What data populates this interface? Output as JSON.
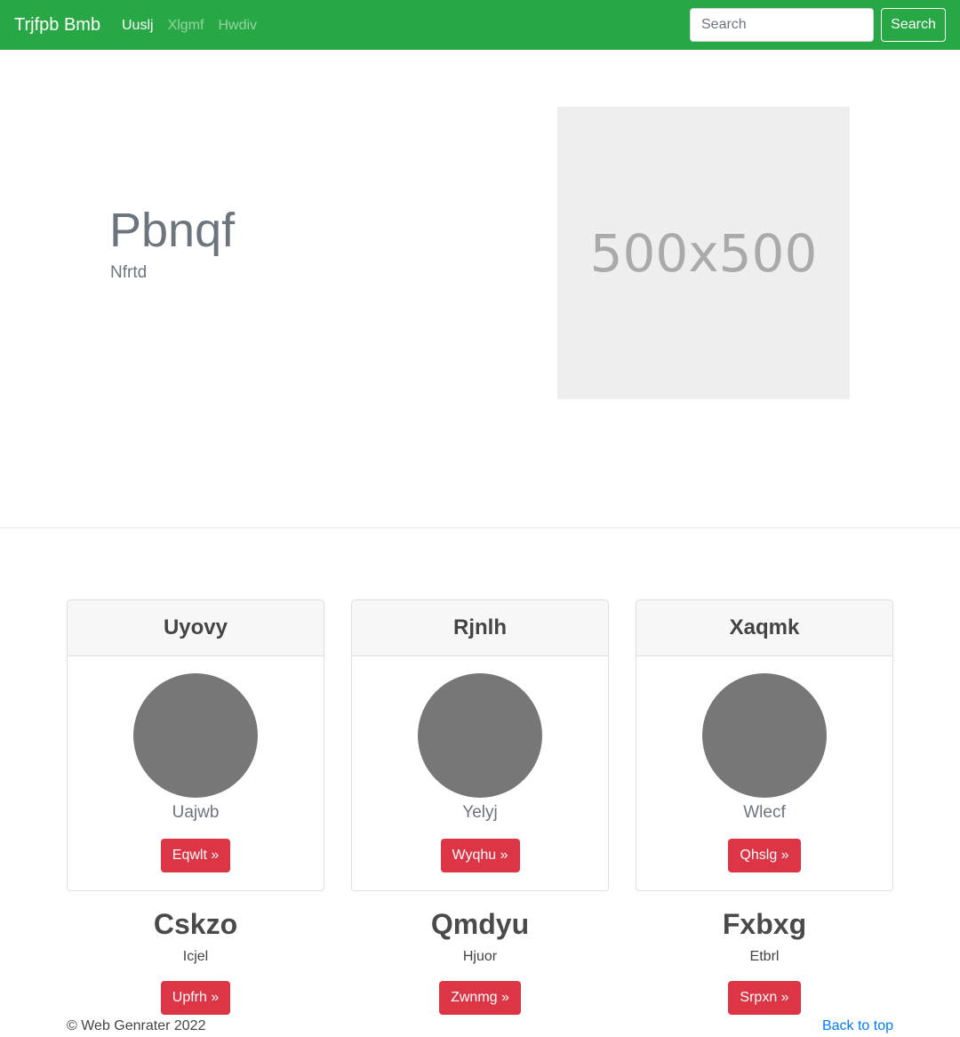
{
  "navbar": {
    "brand": "Trjfpb Bmb",
    "links": [
      "Uuslj",
      "Xlgmf",
      "Hwdiv"
    ],
    "search_placeholder": "Search",
    "search_button": "Search"
  },
  "hero": {
    "title": "Pbnqf",
    "subtitle": "Nfrtd",
    "image_label": "500x500"
  },
  "cards": [
    {
      "title": "Uyovy",
      "name": "Uajwb",
      "button": "Eqwlt »"
    },
    {
      "title": "Rjnlh",
      "name": "Yelyj",
      "button": "Wyqhu »"
    },
    {
      "title": "Xaqmk",
      "name": "Wlecf",
      "button": "Qhslg »"
    }
  ],
  "features": [
    {
      "title": "Cskzo",
      "text": "Icjel",
      "button": "Upfrh »"
    },
    {
      "title": "Qmdyu",
      "text": "Hjuor",
      "button": "Zwnmg »"
    },
    {
      "title": "Fxbxg",
      "text": "Etbrl",
      "button": "Srpxn »"
    }
  ],
  "footer": {
    "copyright": "© Web Genrater 2022",
    "back_to_top": "Back to top"
  },
  "colors": {
    "navbar": "#28a745",
    "button": "#dc3545",
    "link": "#007bff"
  }
}
